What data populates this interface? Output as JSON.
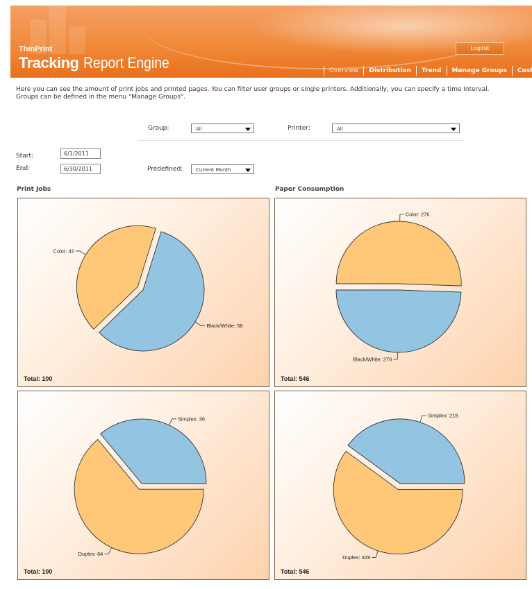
{
  "header": {
    "brand_small": "ThinPrint",
    "brand_bold": "Tracking",
    "brand_rest": "Report Engine",
    "logout_label": "Logout",
    "nav": [
      "Overview",
      "Distribution",
      "Trend",
      "Manage Groups",
      "Costs"
    ],
    "active_tab": "Overview"
  },
  "intro_text": "Here you can see the amount of print jobs and printed pages. You can filter user groups or single printers. Additionally, you can specify a time interval. Groups can be defined in the menu \"Manage Groups\".",
  "filters": {
    "group_label": "Group:",
    "group_value": "All",
    "printer_label": "Printer:",
    "printer_value": "All",
    "start_label": "Start:",
    "start_value": "6/1/2011",
    "end_label": "End:",
    "end_value": "6/30/2011",
    "predefined_label": "Predefined:",
    "predefined_value": "Current Month"
  },
  "sections": {
    "left_title": "Print Jobs",
    "right_title": "Paper Consumption"
  },
  "colors": {
    "slice_a": "#93c4e1",
    "slice_b": "#fec878",
    "header_orange": "#ee8330"
  },
  "chart_data": [
    {
      "type": "pie",
      "title": "Print Jobs",
      "total_label": "Total: 100",
      "slices": [
        {
          "name": "Black/White",
          "value": 58,
          "label": "Black/White: 58"
        },
        {
          "name": "Color",
          "value": 42,
          "label": "Color: 42"
        }
      ]
    },
    {
      "type": "pie",
      "title": "Paper Consumption",
      "total_label": "Total: 546",
      "slices": [
        {
          "name": "Black/White",
          "value": 270,
          "label": "Black/White: 270"
        },
        {
          "name": "Color",
          "value": 276,
          "label": "Color: 276"
        }
      ]
    },
    {
      "type": "pie",
      "title": "Print Jobs",
      "total_label": "Total: 100",
      "slices": [
        {
          "name": "Simplex",
          "value": 36,
          "label": "Simplex: 36"
        },
        {
          "name": "Duplex",
          "value": 64,
          "label": "Duplex: 64"
        }
      ]
    },
    {
      "type": "pie",
      "title": "Paper Consumption",
      "total_label": "Total: 546",
      "slices": [
        {
          "name": "Simplex",
          "value": 218,
          "label": "Simplex: 218"
        },
        {
          "name": "Duplex",
          "value": 328,
          "label": "Duplex: 328"
        }
      ]
    }
  ]
}
